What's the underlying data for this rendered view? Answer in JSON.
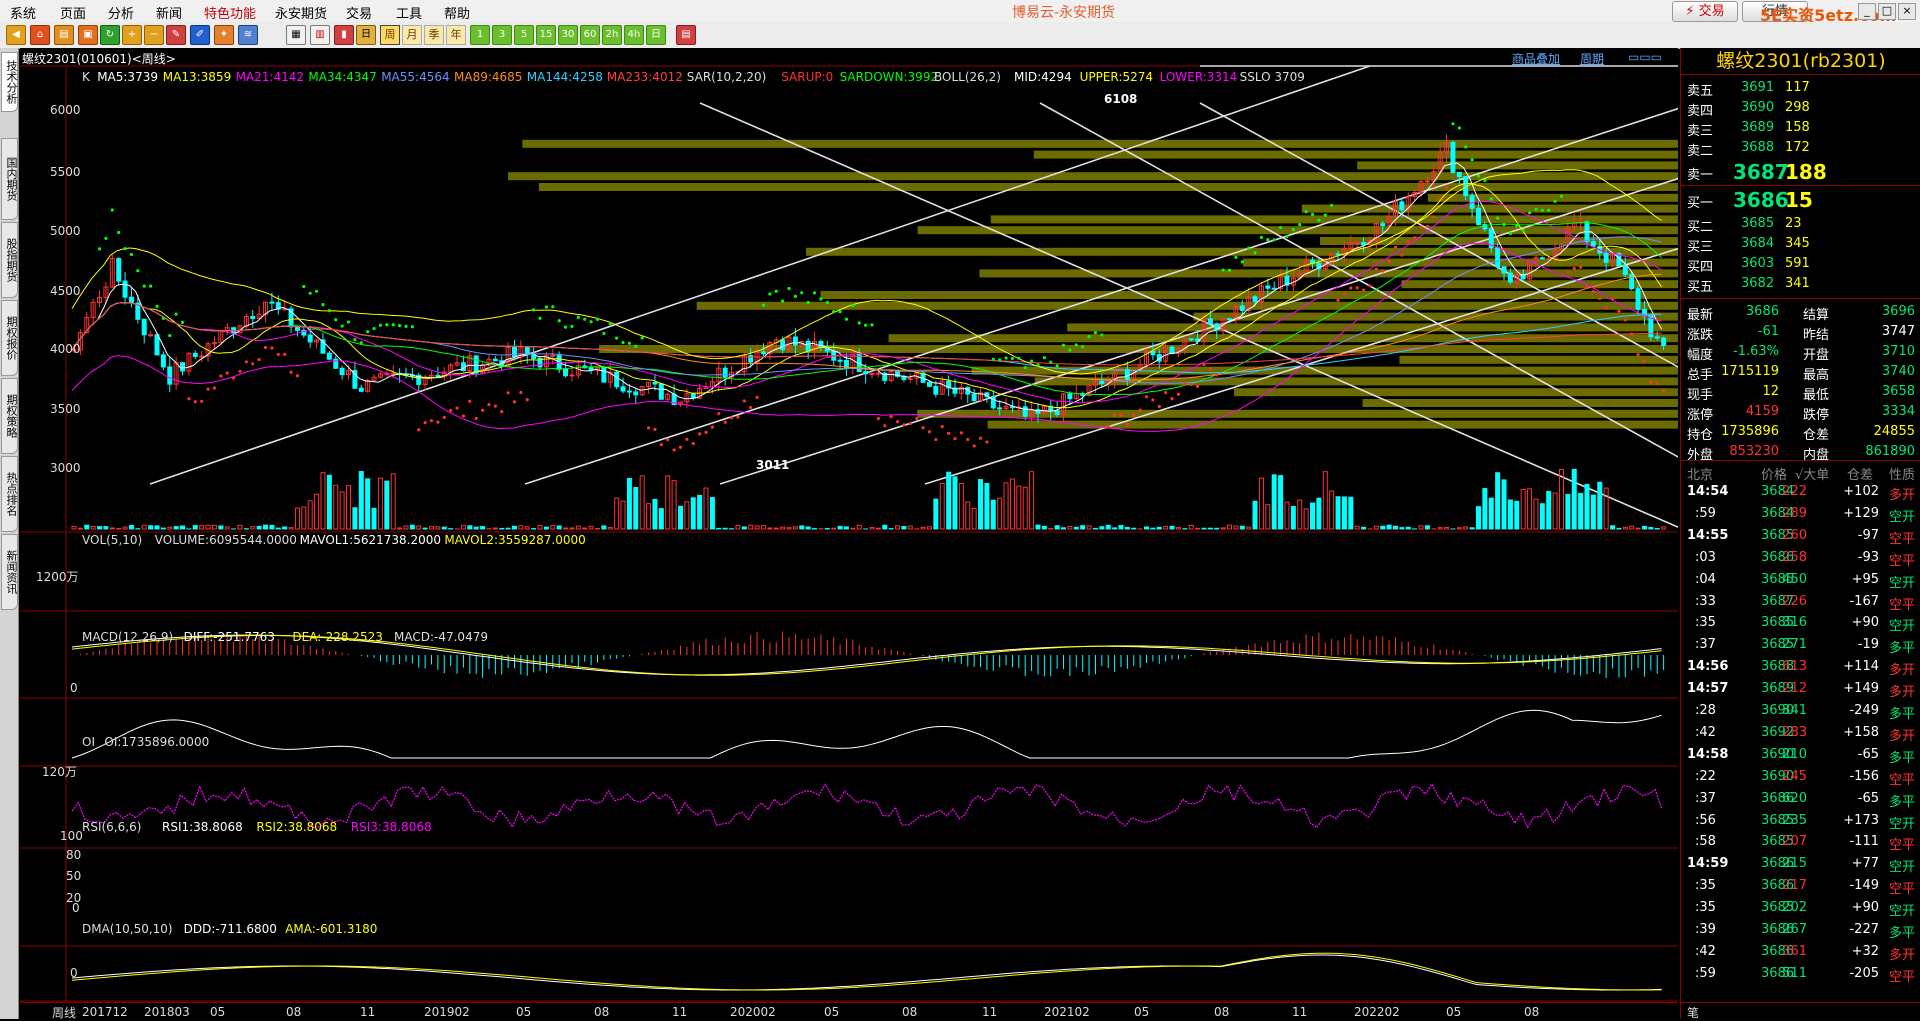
{
  "menu": {
    "items": [
      "系统",
      "页面",
      "分析",
      "新闻",
      "特色功能",
      "永安期货",
      "交易",
      "工具",
      "帮助"
    ],
    "title": "博易云-永安期货",
    "trade_label": "⚡ 交易",
    "hangqing_label": "行情",
    "watermark": "5E实资5etz.com"
  },
  "toolbar": {
    "period_labels": [
      "周",
      "月",
      "季",
      "年"
    ],
    "number_labels": [
      "1",
      "3",
      "5",
      "15",
      "30",
      "60",
      "2h",
      "4h",
      "日"
    ]
  },
  "left_tabs": [
    "技术分析",
    "国内期货",
    "股指期货",
    "期权报价",
    "期权策略",
    "热点排名",
    "新闻资讯"
  ],
  "chart": {
    "header_title": "螺纹2301(010601)<周线>",
    "header_links": [
      "商品叠加",
      "周期"
    ],
    "indicator_main": [
      {
        "text": "K",
        "color": "#dddddd"
      },
      {
        "text": "MA5:3739",
        "color": "#ffffff"
      },
      {
        "text": "MA13:3859",
        "color": "#ffff00"
      },
      {
        "text": "MA21:4142",
        "color": "#ff00ff"
      },
      {
        "text": "MA34:4347",
        "color": "#00ff00"
      },
      {
        "text": "MA55:4564",
        "color": "#6f8fff"
      },
      {
        "text": "MA89:4685",
        "color": "#ff8c1a"
      },
      {
        "text": "MA144:4258",
        "color": "#33ccff"
      },
      {
        "text": "MA233:4012",
        "color": "#ff4040"
      },
      {
        "text": "SAR(10,2,20)",
        "color": "#dddddd"
      },
      {
        "text": "SARUP:0",
        "color": "#ff3030"
      },
      {
        "text": "SARDOWN:3992",
        "color": "#00ff00"
      },
      {
        "text": "BOLL(26,2)",
        "color": "#dddddd"
      },
      {
        "text": "MID:4294",
        "color": "#ffffff"
      },
      {
        "text": "UPPER:5274",
        "color": "#ffff00"
      },
      {
        "text": "LOWER:3314",
        "color": "#ff00ff"
      },
      {
        "text": "SSLO 3709",
        "color": "#dddddd"
      }
    ],
    "indicator_vol": [
      {
        "text": "VOL(5,10)",
        "color": "#dddddd"
      },
      {
        "text": "VOLUME:6095544.0000",
        "color": "#dddddd"
      },
      {
        "text": "MAVOL1:5621738.2000",
        "color": "#ffffff"
      },
      {
        "text": "MAVOL2:3559287.0000",
        "color": "#ffff00"
      }
    ],
    "indicator_macd": [
      {
        "text": "MACD(12,26,9)",
        "color": "#dddddd"
      },
      {
        "text": "DIFF:-251.7763",
        "color": "#ffffff"
      },
      {
        "text": "DEA:-228.2523",
        "color": "#ffff00"
      },
      {
        "text": "MACD:-47.0479",
        "color": "#dddddd"
      }
    ],
    "indicator_oi": [
      {
        "text": "OI",
        "color": "#dddddd"
      },
      {
        "text": "OI:1735896.0000",
        "color": "#dddddd"
      }
    ],
    "indicator_rsi": [
      {
        "text": "RSI(6,6,6)",
        "color": "#dddddd"
      },
      {
        "text": "RSI1:38.8068",
        "color": "#ffffff"
      },
      {
        "text": "RSI2:38.8068",
        "color": "#ffff00"
      },
      {
        "text": "RSI3:38.8068",
        "color": "#ff00ff"
      }
    ],
    "indicator_dma": [
      {
        "text": "DMA(10,50,10)",
        "color": "#dddddd"
      },
      {
        "text": "DDD:-711.6800",
        "color": "#ffffff"
      },
      {
        "text": "AMA:-601.3180",
        "color": "#ffff00"
      }
    ],
    "price_axis": [
      "6000",
      "5500",
      "5000",
      "4500",
      "4000",
      "3500",
      "3000"
    ],
    "vol_axis": "1200万",
    "macd_axis": "0",
    "oi_axis": "120万",
    "rsi_axis": [
      "100",
      "80",
      "50",
      "20",
      "0"
    ],
    "dma_axis": "0",
    "high_marker": "6108",
    "low_marker": "3011",
    "time_axis_label": "周线",
    "time_axis": [
      "201712",
      "201803",
      "05",
      "08",
      "11",
      "201902",
      "05",
      "08",
      "11",
      "202002",
      "05",
      "08",
      "11",
      "202102",
      "05",
      "08",
      "11",
      "202202",
      "05",
      "08"
    ]
  },
  "quote": {
    "title": "螺纹2301(rb2301)",
    "asks": [
      {
        "label": "卖五",
        "price": "3691",
        "vol": "117"
      },
      {
        "label": "卖四",
        "price": "3690",
        "vol": "298"
      },
      {
        "label": "卖三",
        "price": "3689",
        "vol": "158"
      },
      {
        "label": "卖二",
        "price": "3688",
        "vol": "172"
      },
      {
        "label": "卖一",
        "price": "3687",
        "vol": "188"
      }
    ],
    "bids": [
      {
        "label": "买一",
        "price": "3686",
        "vol": "15"
      },
      {
        "label": "买二",
        "price": "3685",
        "vol": "23"
      },
      {
        "label": "买三",
        "price": "3684",
        "vol": "345"
      },
      {
        "label": "买四",
        "price": "3603",
        "vol": "591"
      },
      {
        "label": "买五",
        "price": "3682",
        "vol": "341"
      }
    ],
    "stats": [
      {
        "l1": "最新",
        "v1": "3686",
        "c1": "#00e676",
        "l2": "结算",
        "v2": "3696",
        "c2": "#00e676"
      },
      {
        "l1": "涨跌",
        "v1": "-61",
        "c1": "#00e676",
        "l2": "昨结",
        "v2": "3747",
        "c2": "#ffffff"
      },
      {
        "l1": "幅度",
        "v1": "-1.63%",
        "c1": "#00e676",
        "l2": "开盘",
        "v2": "3710",
        "c2": "#00e676"
      },
      {
        "l1": "总手",
        "v1": "1715119",
        "c1": "#ffff00",
        "l2": "最高",
        "v2": "3740",
        "c2": "#00e676"
      },
      {
        "l1": "现手",
        "v1": "12",
        "c1": "#ffff00",
        "l2": "最低",
        "v2": "3658",
        "c2": "#00e676"
      },
      {
        "l1": "涨停",
        "v1": "4159",
        "c1": "#ff3232",
        "l2": "跌停",
        "v2": "3334",
        "c2": "#00e676"
      },
      {
        "l1": "持仓",
        "v1": "1735896",
        "c1": "#ffff00",
        "l2": "仓差",
        "v2": "24855",
        "c2": "#ffff00"
      },
      {
        "l1": "外盘",
        "v1": "853230",
        "c1": "#ff3232",
        "l2": "内盘",
        "v2": "861890",
        "c2": "#00e676"
      }
    ],
    "tick_header": [
      "北京",
      "价格",
      "√大单",
      "仓差",
      "性质"
    ],
    "ticks": [
      {
        "time": "14:54",
        "price": "3684",
        "vol": "222",
        "vc": "#ff3232",
        "diff": "+102",
        "nature": "多开",
        "nc": "#ff3232"
      },
      {
        "time": ":59",
        "price": "3684",
        "vol": "289",
        "vc": "#ff3232",
        "diff": "+129",
        "nature": "空开",
        "nc": "#00e676"
      },
      {
        "time": "14:55",
        "price": "3685",
        "vol": "260",
        "vc": "#ff3232",
        "diff": "-97",
        "nature": "空平",
        "nc": "#ff3232"
      },
      {
        "time": ":03",
        "price": "3686",
        "vol": "258",
        "vc": "#ff3232",
        "diff": "-93",
        "nature": "空平",
        "nc": "#ff3232"
      },
      {
        "time": ":04",
        "price": "3685",
        "vol": "450",
        "vc": "#00e676",
        "diff": "+95",
        "nature": "空开",
        "nc": "#00e676"
      },
      {
        "time": ":33",
        "price": "3687",
        "vol": "226",
        "vc": "#ff3232",
        "diff": "-167",
        "nature": "空平",
        "nc": "#ff3232"
      },
      {
        "time": ":35",
        "price": "3685",
        "vol": "316",
        "vc": "#00e676",
        "diff": "+90",
        "nature": "空开",
        "nc": "#00e676"
      },
      {
        "time": ":37",
        "price": "3685",
        "vol": "271",
        "vc": "#00e676",
        "diff": "-19",
        "nature": "多平",
        "nc": "#00e676"
      },
      {
        "time": "14:56",
        "price": "3688",
        "vol": "613",
        "vc": "#ff3232",
        "diff": "+114",
        "nature": "多开",
        "nc": "#ff3232"
      },
      {
        "time": "14:57",
        "price": "3689",
        "vol": "212",
        "vc": "#ff3232",
        "diff": "+149",
        "nature": "多开",
        "nc": "#ff3232"
      },
      {
        "time": ":28",
        "price": "3690",
        "vol": "341",
        "vc": "#00e676",
        "diff": "-249",
        "nature": "多平",
        "nc": "#00e676"
      },
      {
        "time": ":42",
        "price": "3692",
        "vol": "283",
        "vc": "#ff3232",
        "diff": "+158",
        "nature": "多开",
        "nc": "#ff3232"
      },
      {
        "time": "14:58",
        "price": "3690",
        "vol": "210",
        "vc": "#00e676",
        "diff": "-65",
        "nature": "多平",
        "nc": "#00e676"
      },
      {
        "time": ":22",
        "price": "3690",
        "vol": "245",
        "vc": "#ff3232",
        "diff": "-156",
        "nature": "空平",
        "nc": "#ff3232"
      },
      {
        "time": ":37",
        "price": "3686",
        "vol": "620",
        "vc": "#00e676",
        "diff": "-65",
        "nature": "多平",
        "nc": "#00e676"
      },
      {
        "time": ":56",
        "price": "3685",
        "vol": "235",
        "vc": "#00e676",
        "diff": "+173",
        "nature": "空开",
        "nc": "#00e676"
      },
      {
        "time": ":58",
        "price": "3685",
        "vol": "207",
        "vc": "#ff3232",
        "diff": "-111",
        "nature": "空平",
        "nc": "#ff3232"
      },
      {
        "time": "14:59",
        "price": "3686",
        "vol": "215",
        "vc": "#00e676",
        "diff": "+77",
        "nature": "空开",
        "nc": "#00e676"
      },
      {
        "time": ":35",
        "price": "3686",
        "vol": "217",
        "vc": "#ff3232",
        "diff": "-149",
        "nature": "空平",
        "nc": "#ff3232"
      },
      {
        "time": ":35",
        "price": "3685",
        "vol": "202",
        "vc": "#00e676",
        "diff": "+90",
        "nature": "空开",
        "nc": "#00e676"
      },
      {
        "time": ":39",
        "price": "3686",
        "vol": "267",
        "vc": "#00e676",
        "diff": "-227",
        "nature": "多平",
        "nc": "#00e676"
      },
      {
        "time": ":42",
        "price": "3686",
        "vol": "361",
        "vc": "#ff3232",
        "diff": "+32",
        "nature": "多开",
        "nc": "#ff3232"
      },
      {
        "time": ":59",
        "price": "3686",
        "vol": "511",
        "vc": "#00e676",
        "diff": "-205",
        "nature": "空平",
        "nc": "#ff3232"
      }
    ],
    "bottom_tab": "笔"
  }
}
